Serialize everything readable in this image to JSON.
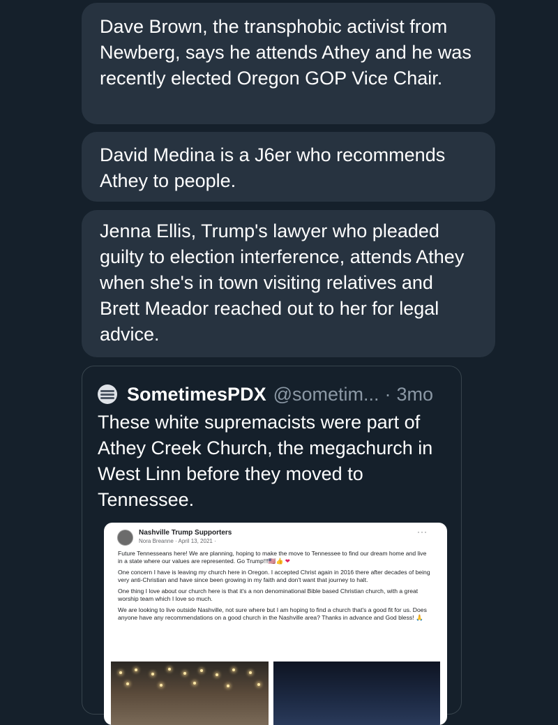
{
  "replies": [
    "Dave Brown, the transphobic activist from Newberg, says he attends Athey and he was recently elected Oregon GOP Vice Chair.",
    "David Medina is a J6er who recommends Athey to people.",
    "Jenna Ellis, Trump's lawyer who pleaded guilty to election interference, attends Athey when she's in town visiting relatives and Brett Meador reached out to her for legal advice."
  ],
  "quoted_post": {
    "name": "SometimesPDX",
    "handle": "@sometim...",
    "separator": "·",
    "time": "3mo",
    "text": "These white supremacists were part of Athey Creek Church, the megachurch in West Linn before they moved to Tennessee.",
    "embedded_screenshot": {
      "group": "Nashville Trump Supporters",
      "author_date": "Nora Breanne · April 13, 2021 ·",
      "paragraphs": [
        "Future Tennesseans here! We are planning, hoping to make the move to Tennessee to find our dream home and live in a state where our values are represented. Go Trump!!!",
        "One concern I have is leaving my church here in Oregon. I accepted Christ again in 2016 there after decades of being very anti-Christian and have since been growing in my faith and don't want that journey to halt.",
        "One thing I love about our church here is that it's a non denominational Bible based Christian church, with a great worship team which I love so much.",
        "We are looking to live outside Nashville, not sure where but I am hoping to find a church that's a good fit for us. Does anyone have any recommendations on a good church in the Nashville area? Thanks in advance and God bless!"
      ],
      "emoji_after_p1": "🇺🇸👍",
      "heart": "❤",
      "emoji_after_p4": "🙏",
      "more_glyph": "···"
    }
  },
  "colors": {
    "background": "#15202b",
    "bubble": "#273340",
    "secondary_text": "#8b98a5"
  }
}
